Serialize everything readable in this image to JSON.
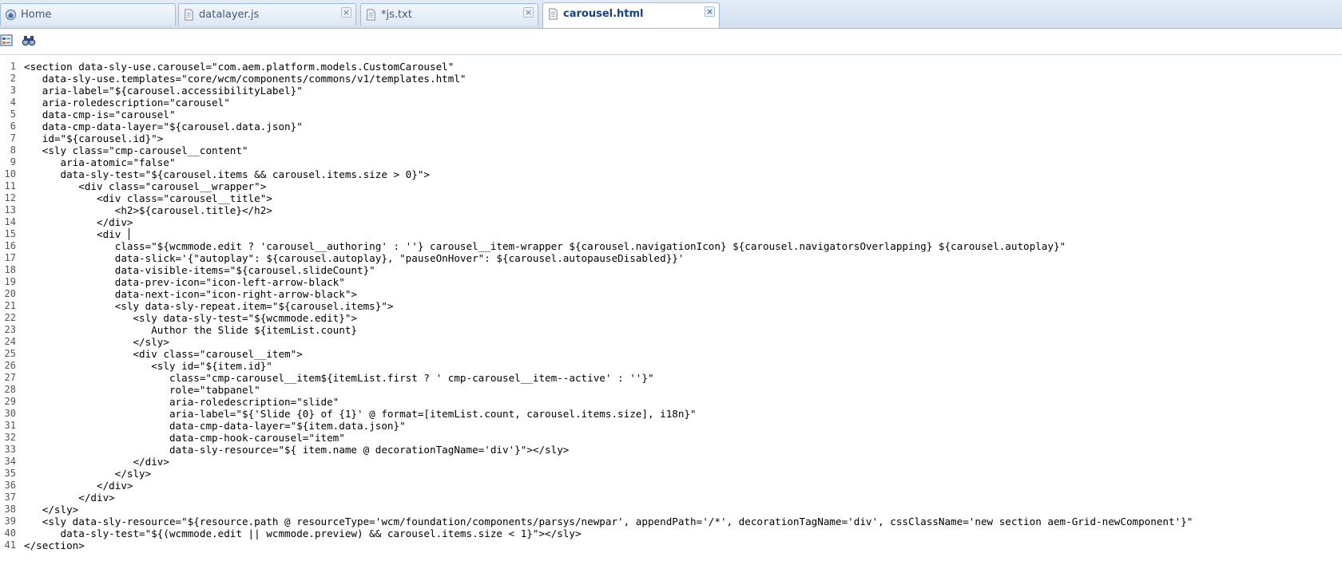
{
  "tabs": [
    {
      "label": "Home",
      "icon": "home-icon",
      "closable": false,
      "active": false
    },
    {
      "label": "datalayer.js",
      "icon": "document-icon",
      "closable": true,
      "active": false
    },
    {
      "label": "*js.txt",
      "icon": "document-icon",
      "closable": true,
      "active": false
    },
    {
      "label": "carousel.html",
      "icon": "document-icon",
      "closable": true,
      "active": true
    }
  ],
  "toolbar": {
    "buttons": [
      {
        "name": "tree-view-button",
        "icon": "tree-view-icon"
      },
      {
        "name": "find-button",
        "icon": "binoculars-icon"
      }
    ]
  },
  "editor": {
    "lines": [
      {
        "n": "1",
        "text": "<section data-sly-use.carousel=\"com.aem.platform.models.CustomCarousel\""
      },
      {
        "n": "2",
        "text": "   data-sly-use.templates=\"core/wcm/components/commons/v1/templates.html\""
      },
      {
        "n": "3",
        "text": "   aria-label=\"${carousel.accessibilityLabel}\""
      },
      {
        "n": "4",
        "text": "   aria-roledescription=\"carousel\""
      },
      {
        "n": "5",
        "text": "   data-cmp-is=\"carousel\""
      },
      {
        "n": "6",
        "text": "   data-cmp-data-layer=\"${carousel.data.json}\""
      },
      {
        "n": "7",
        "text": "   id=\"${carousel.id}\">"
      },
      {
        "n": "8",
        "text": "   <sly class=\"cmp-carousel__content\""
      },
      {
        "n": "9",
        "text": "      aria-atomic=\"false\""
      },
      {
        "n": "10",
        "text": "      data-sly-test=\"${carousel.items && carousel.items.size > 0}\">"
      },
      {
        "n": "11",
        "text": "         <div class=\"carousel__wrapper\">"
      },
      {
        "n": "12",
        "text": "            <div class=\"carousel__title\">"
      },
      {
        "n": "13",
        "text": "               <h2>${carousel.title}</h2>"
      },
      {
        "n": "14",
        "text": "            </div>"
      },
      {
        "n": "15",
        "text": "            <div"
      },
      {
        "n": "16",
        "text": "               class=\"${wcmmode.edit ? 'carousel__authoring' : ''} carousel__item-wrapper ${carousel.navigationIcon} ${carousel.navigatorsOverlapping} ${carousel.autoplay}\""
      },
      {
        "n": "17",
        "text": "               data-slick='{\"autoplay\": ${carousel.autoplay}, \"pauseOnHover\": ${carousel.autopauseDisabled}}'"
      },
      {
        "n": "18",
        "text": "               data-visible-items=\"${carousel.slideCount}\""
      },
      {
        "n": "19",
        "text": "               data-prev-icon=\"icon-left-arrow-black\""
      },
      {
        "n": "20",
        "text": "               data-next-icon=\"icon-right-arrow-black\">"
      },
      {
        "n": "21",
        "text": "               <sly data-sly-repeat.item=\"${carousel.items}\">"
      },
      {
        "n": "22",
        "text": "                  <sly data-sly-test=\"${wcmmode.edit}\">"
      },
      {
        "n": "23",
        "text": "                     Author the Slide ${itemList.count}"
      },
      {
        "n": "24",
        "text": "                  </sly>"
      },
      {
        "n": "25",
        "text": "                  <div class=\"carousel__item\">"
      },
      {
        "n": "26",
        "text": "                     <sly id=\"${item.id}\""
      },
      {
        "n": "27",
        "text": "                        class=\"cmp-carousel__item${itemList.first ? ' cmp-carousel__item--active' : ''}\""
      },
      {
        "n": "28",
        "text": "                        role=\"tabpanel\""
      },
      {
        "n": "29",
        "text": "                        aria-roledescription=\"slide\""
      },
      {
        "n": "30",
        "text": "                        aria-label=\"${'Slide {0} of {1}' @ format=[itemList.count, carousel.items.size], i18n}\""
      },
      {
        "n": "31",
        "text": "                        data-cmp-data-layer=\"${item.data.json}\""
      },
      {
        "n": "32",
        "text": "                        data-cmp-hook-carousel=\"item\""
      },
      {
        "n": "33",
        "text": "                        data-sly-resource=\"${ item.name @ decorationTagName='div'}\"></sly>"
      },
      {
        "n": "34",
        "text": "                  </div>"
      },
      {
        "n": "35",
        "text": "               </sly>"
      },
      {
        "n": "36",
        "text": "            </div>"
      },
      {
        "n": "37",
        "text": "         </div>"
      },
      {
        "n": "38",
        "text": "   </sly>"
      },
      {
        "n": "39",
        "text": "   <sly data-sly-resource=\"${resource.path @ resourceType='wcm/foundation/components/parsys/newpar', appendPath='/*', decorationTagName='div', cssClassName='new section aem-Grid-newComponent'}\""
      },
      {
        "n": "40",
        "text": "      data-sly-test=\"${(wcmmode.edit || wcmmode.preview) && carousel.items.size < 1}\"></sly>"
      },
      {
        "n": "41",
        "text": "</section>"
      }
    ]
  }
}
